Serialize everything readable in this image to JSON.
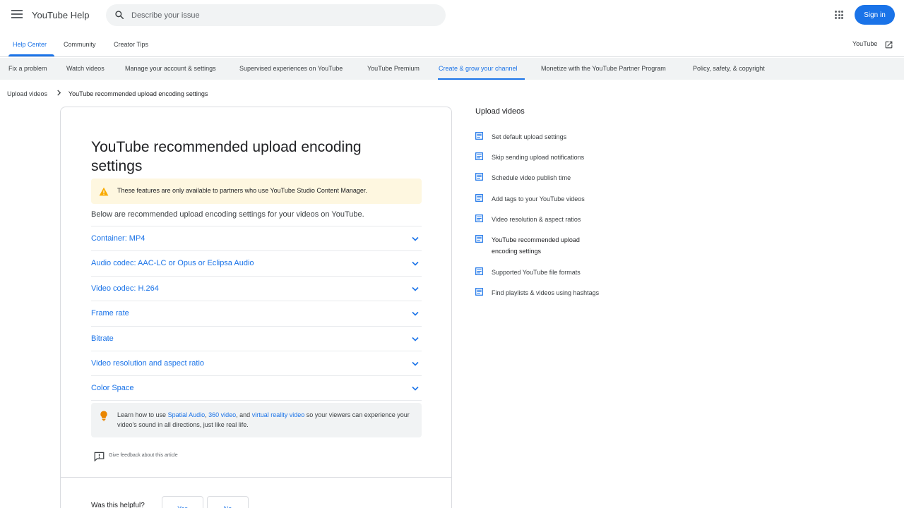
{
  "header": {
    "app_title": "YouTube Help",
    "search_placeholder": "Describe your issue",
    "signin_label": "Sign in"
  },
  "tabs": [
    {
      "label": "Help Center",
      "active": true
    },
    {
      "label": "Community",
      "active": false
    },
    {
      "label": "Creator Tips",
      "active": false
    }
  ],
  "external_link": "YouTube",
  "categories": [
    {
      "label": "Fix a problem"
    },
    {
      "label": "Watch videos"
    },
    {
      "label": "Manage your account & settings"
    },
    {
      "label": "Supervised experiences on YouTube"
    },
    {
      "label": "YouTube Premium"
    },
    {
      "label": "Create & grow your channel",
      "active": true
    },
    {
      "label": "Monetize with the YouTube Partner Program"
    },
    {
      "label": "Policy, safety, & copyright"
    }
  ],
  "breadcrumb": {
    "parent": "Upload videos",
    "current": "YouTube recommended upload encoding settings"
  },
  "article": {
    "title": "YouTube recommended upload encoding settings",
    "warning": "These features are only available to partners who use YouTube Studio Content Manager.",
    "intro": "Below are recommended upload encoding settings for your videos on YouTube.",
    "sections": [
      {
        "label": "Container: MP4"
      },
      {
        "label": "Audio codec: AAC-LC or Opus or Eclipsa Audio"
      },
      {
        "label": "Video codec: H.264"
      },
      {
        "label": "Frame rate"
      },
      {
        "label": "Bitrate"
      },
      {
        "label": "Video resolution and aspect ratio"
      },
      {
        "label": "Color Space"
      }
    ],
    "tip": {
      "prefix": "Learn how to use ",
      "link1": "Spatial Audio",
      "sep1": ", ",
      "link2": "360 video",
      "sep2": ", and ",
      "link3": "virtual reality video",
      "suffix": " so your viewers can experience your video's sound in all directions, just like real life."
    },
    "feedback": "Give feedback about this article",
    "helpful_question": "Was this helpful?",
    "yes_label": "Yes",
    "no_label": "No"
  },
  "sidebar": {
    "title": "Upload videos",
    "items": [
      {
        "label": "Set default upload settings"
      },
      {
        "label": "Skip sending upload notifications"
      },
      {
        "label": "Schedule video publish time"
      },
      {
        "label": "Add tags to your YouTube videos"
      },
      {
        "label": "Video resolution & aspect ratios"
      },
      {
        "label": "YouTube recommended upload encoding settings",
        "active": true
      },
      {
        "label": "Supported YouTube file formats"
      },
      {
        "label": "Find playlists & videos using hashtags"
      }
    ]
  },
  "colors": {
    "accent": "#1a73e8",
    "warning_bg": "#fef7e0",
    "warning_icon": "#f9ab00",
    "tip_bg": "#f1f3f4",
    "nav_bg": "#f1f3f4"
  },
  "icons": [
    "menu-icon",
    "search-icon",
    "apps-icon",
    "external-link-icon",
    "chevron-right-icon",
    "warning-icon",
    "chevron-down-icon",
    "lightbulb-icon",
    "feedback-icon",
    "article-icon"
  ]
}
